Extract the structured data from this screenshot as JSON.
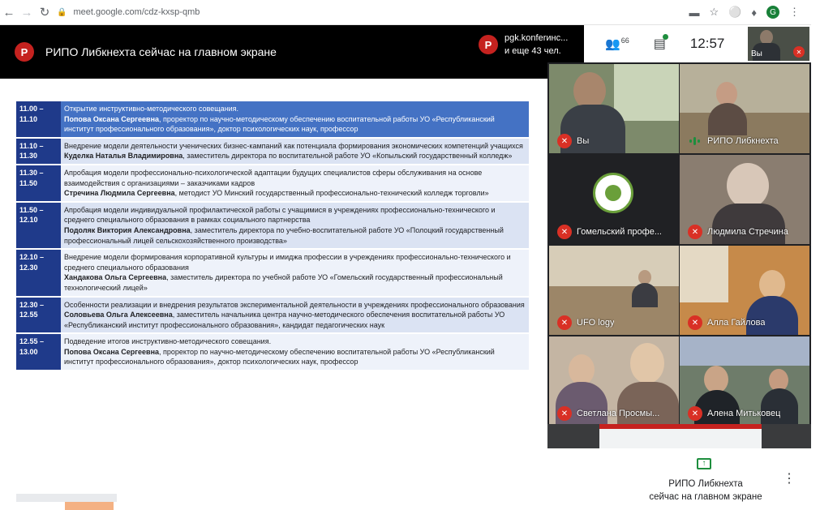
{
  "browser": {
    "url": "meet.google.com/cdz-kxsp-qmb",
    "profile_initial": "G"
  },
  "presentation_bar": {
    "presenter_initial": "Р",
    "title": "РИПО Либкнехта сейчас на главном экране",
    "presenter_name": "pgk.konferинс...",
    "others": "и еще 43 чел."
  },
  "top_controls": {
    "people_count": "66",
    "clock": "12:57",
    "self_label": "Вы"
  },
  "schedule": [
    {
      "time": "11.00 – 11.10",
      "title": "Открытие инструктивно-методического совещания.",
      "speaker": "Попова Оксана Сергеевна",
      "role": ", проректор по научно-методическому обеспечению воспитательной работы УО «Республиканский институт профессионального образования», доктор психологических наук, профессор",
      "style": "hl"
    },
    {
      "time": "11.10 – 11.30",
      "title": "Внедрение модели деятельности ученических бизнес-кампаний как потенциала формирования экономических компетенций учащихся",
      "speaker": "Куделка Наталья Владимировна",
      "role": ", заместитель директора по воспитательной работе УО «Копыльский государственный колледж»",
      "style": "alt"
    },
    {
      "time": "11.30 – 11.50",
      "title": "Апробация модели профессионально-психологической адаптации будущих специалистов сферы обслуживания на основе взаимодействия с организациями – заказчиками кадров",
      "speaker": "Стречина Людмила Сергеевна",
      "role": ", методист УО Минский государственный профессионально-технический колледж торговли»",
      "style": "plain"
    },
    {
      "time": "11.50 – 12.10",
      "title": "Апробация модели индивидуальной профилактической работы с учащимися в учреждениях профессионально-технического и среднего специального образования в рамках социального партнерства",
      "speaker": "Подоляк Виктория Александровна",
      "role": ", заместитель директора по учебно-воспитательной работе УО «Полоцкий государственный профессиональный лицей сельскохозяйственного производства»",
      "style": "alt"
    },
    {
      "time": "12.10 – 12.30",
      "title": "Внедрение модели формирования корпоративной культуры и имиджа профессии в учреждениях профессионально-технического и среднего специального образования",
      "speaker": "Хандакова Ольга Сергеевна",
      "role": ", заместитель директора по учебной работе УО «Гомельский государственный профессиональный технологический лицей»",
      "style": "plain"
    },
    {
      "time": "12.30 – 12.55",
      "title": "Особенности реализации и внедрения результатов экспериментальной деятельности в учреждениях профессионального образования",
      "speaker": "Соловьева Ольга Алексеевна",
      "role": ", заместитель начальника центра научно-методического обеспечения воспитательной работы УО «Республиканский институт профессионального образования», кандидат педагогических наук",
      "style": "alt"
    },
    {
      "time": "12.55 – 13.00",
      "title": "Подведение итогов инструктивно-методического совещания.",
      "speaker": "Попова Оксана Сергеевна",
      "role": ", проректор по научно-методическому обеспечению воспитательной работы УО «Республиканский институт профессионального образования», доктор психологических наук, профессор",
      "style": "plain"
    }
  ],
  "participants": [
    {
      "name": "Вы",
      "state": "muted"
    },
    {
      "name": "РИПО Либкнехта",
      "state": "speaking"
    },
    {
      "name": "Гомельский профе...",
      "state": "muted"
    },
    {
      "name": "Людмила Стречина",
      "state": "muted"
    },
    {
      "name": "UFO logy",
      "state": "muted"
    },
    {
      "name": "Алла Гайлова",
      "state": "muted"
    },
    {
      "name": "Светлана Просмы...",
      "state": "muted"
    },
    {
      "name": "Алена Митьковец",
      "state": "muted"
    }
  ],
  "presenting_panel": {
    "line1": "РИПО Либкнехта",
    "line2": "сейчас на главном экране"
  },
  "colors": {
    "presenter_red": "#c5221f",
    "mute_red": "#d93025",
    "speaking_green": "#1e8e3e",
    "time_blue": "#1f3a8a",
    "highlight_blue": "#4472c4"
  }
}
